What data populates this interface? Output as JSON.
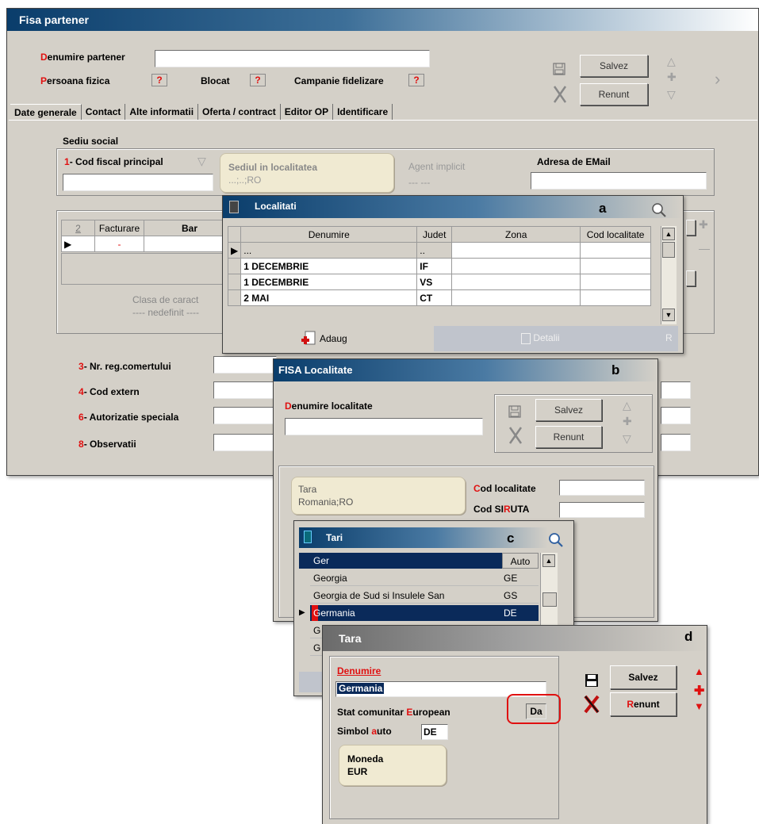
{
  "main": {
    "title": "Fisa partener",
    "partner_name_label": "Denumire partener",
    "persoana_label": "Persoana fizica",
    "blocat_label": "Blocat",
    "campanie_label": "Campanie fidelizare",
    "q": "?",
    "save": "Salvez",
    "cancel": "Renunt",
    "tabs": [
      "Date generale",
      "Contact",
      "Alte informatii",
      "Oferta / contract",
      "Editor OP",
      "Identificare"
    ],
    "sediu_social": "Sediu social",
    "cod_fiscal_num": "1",
    "cod_fiscal_label": "- Cod fiscal principal",
    "sediul_label": "Sediul in localitatea",
    "sediul_value": "...;..;RO",
    "agent_label": "Agent implicit",
    "agent_value": "--- ---",
    "email_label": "Adresa de EMail",
    "grid_num": "2",
    "grid_col1": "Facturare",
    "grid_col2": "Bar",
    "clasa_label": "Clasa de caract",
    "clasa_value": "---- nedefinit ----",
    "fields": [
      {
        "num": "3",
        "label": "- Nr. reg.comertului"
      },
      {
        "num": "4",
        "label": "- Cod extern"
      },
      {
        "num": "6",
        "label": "- Autorizatie speciala"
      },
      {
        "num": "8",
        "label": "- Observatii"
      }
    ]
  },
  "localitati": {
    "letter": "a",
    "title": "Localitati",
    "columns": [
      "Denumire",
      "Judet",
      "Zona",
      "Cod localitate"
    ],
    "rows": [
      [
        "...",
        "..",
        "",
        ""
      ],
      [
        "1 DECEMBRIE",
        "IF",
        "",
        ""
      ],
      [
        "1 DECEMBRIE",
        "VS",
        "",
        ""
      ],
      [
        "2 MAI",
        "CT",
        "",
        ""
      ]
    ],
    "add_label": "Adaug",
    "details_label": "Detalii",
    "extra_label": "R"
  },
  "fisa_localitate": {
    "letter": "b",
    "title": "FISA Localitate",
    "denumire_label": "Denumire localitate",
    "save": "Salvez",
    "cancel": "Renunt",
    "tara_label": "Tara",
    "tara_value": "Romania;RO",
    "cod_loc_label": "Cod localitate",
    "siruta_label": "Cod SIRUTA"
  },
  "tari": {
    "letter": "c",
    "title": "Tari",
    "search_value": "Ger",
    "auto_header": "Auto",
    "rows": [
      [
        "Georgia",
        "GE"
      ],
      [
        "Georgia de Sud si Insulele San",
        "GS"
      ],
      [
        "Germania",
        "DE"
      ],
      [
        "G",
        ""
      ],
      [
        "G",
        ""
      ]
    ]
  },
  "tara": {
    "letter": "d",
    "title": "Tara",
    "denumire_label": "Denumire",
    "denumire_value": "Germania",
    "stat_label": "Stat comunitar European",
    "stat_value": "Da",
    "simbol_label": "Simbol auto",
    "simbol_value": "DE",
    "moneda_label": "Moneda",
    "moneda_value": "EUR",
    "save": "Salvez",
    "cancel": "Renunt"
  }
}
